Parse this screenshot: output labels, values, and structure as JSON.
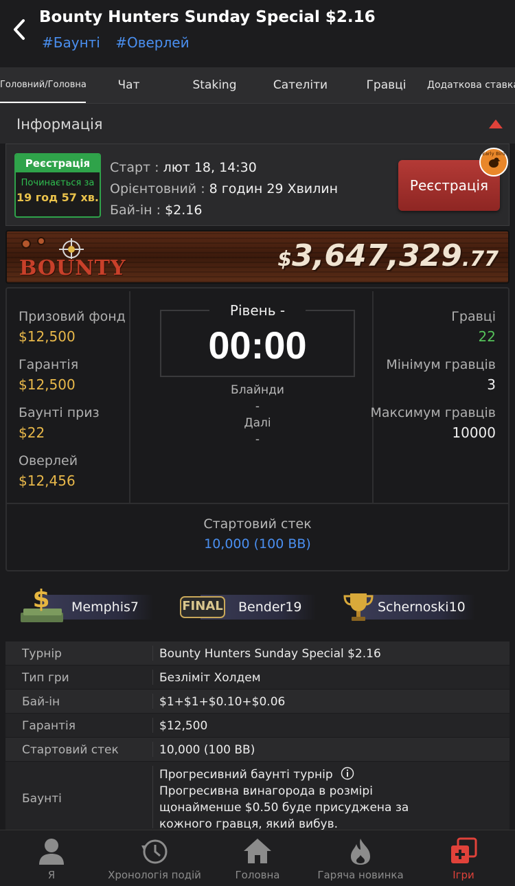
{
  "header": {
    "title": "Bounty Hunters Sunday Special $2.16",
    "tags": [
      "#Баунті",
      "#Оверлей"
    ]
  },
  "tabs": [
    "Головний/Головна",
    "Чат",
    "Staking",
    "Сателіти",
    "Гравці",
    "Додаткова ставка"
  ],
  "info": {
    "title": "Інформація",
    "badge": {
      "top": "Реєстрація",
      "mid": "Починається за",
      "time": "19 год 57 хв."
    },
    "start_label": "Старт :",
    "start_value": "лют 18, 14:30",
    "est_label": "Орієнтовний :",
    "est_value": "8 годин 29 Хвилин",
    "buyin_label": "Бай-ін :",
    "buyin_value": "$2.16",
    "register_button": "Реєстрація",
    "early_bird": "Early Bird"
  },
  "banner": {
    "word": "BOUNTY",
    "dollar": "$",
    "amount": "3,647,329",
    "cents": ".77"
  },
  "stats": {
    "prize_pool_label": "Призовий фонд",
    "prize_pool": "$12,500",
    "guarantee_label": "Гарантія",
    "guarantee": "$12,500",
    "bounty_prize_label": "Баунті приз",
    "bounty_prize": "$22",
    "overlay_label": "Оверлей",
    "overlay": "$12,456",
    "level_label": "Рівень -",
    "clock": "00:00",
    "blinds_label": "Блайнди",
    "blinds_value": "-",
    "next_label": "Далі",
    "next_value": "-",
    "players_label": "Гравці",
    "players": "22",
    "min_players_label": "Мінімум гравців",
    "min_players": "3",
    "max_players_label": "Максимум гравців",
    "max_players": "10000",
    "starting_stack_label": "Стартовий стек",
    "starting_stack": "10,000 (100 BB)"
  },
  "winners": [
    {
      "icon": "dollar-money-icon",
      "name": "Memphis7"
    },
    {
      "icon": "final-badge-icon",
      "badge_text": "FINAL",
      "name": "Bender19"
    },
    {
      "icon": "trophy-icon",
      "name": "Schernoski10"
    }
  ],
  "details": [
    {
      "key": "Турнір",
      "value": "Bounty Hunters Sunday Special $2.16"
    },
    {
      "key": "Тип гри",
      "value": "Безліміт Холдем"
    },
    {
      "key": "Бай-ін",
      "value": "$1+$1+$0.10+$0.06"
    },
    {
      "key": "Гарантія",
      "value": "$12,500"
    },
    {
      "key": "Стартовий стек",
      "value": "10,000 (100 BB)"
    },
    {
      "key": "Баунті",
      "value_title": "Прогресивний баунті турнір",
      "value_body_1": "Прогресивна винагорода в розмірі",
      "value_body_2": "щонайменше $0.50 буде присуджена за",
      "value_body_3": "кожного гравця, який вибув."
    }
  ],
  "bottom_nav": [
    {
      "label": "Я",
      "icon": "user-icon"
    },
    {
      "label": "Хронологія подій",
      "icon": "history-icon"
    },
    {
      "label": "Головна",
      "icon": "home-icon"
    },
    {
      "label": "Гаряча новинка",
      "icon": "fire-icon"
    },
    {
      "label": "Ігри",
      "icon": "games-icon",
      "active": true
    }
  ],
  "colors": {
    "accent_red": "#e0423a",
    "link_blue": "#4a8ff0",
    "gold": "#e8b84a",
    "green": "#2fa34a"
  }
}
